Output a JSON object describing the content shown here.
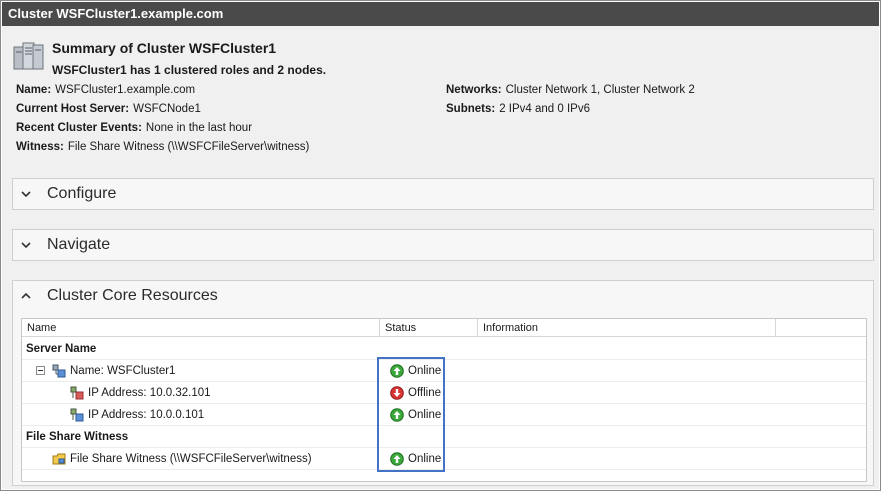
{
  "window": {
    "title": "Cluster WSFCluster1.example.com"
  },
  "summary": {
    "icon": "cluster-server-icon",
    "title": "Summary of Cluster WSFCluster1",
    "subtitle": "WSFCluster1 has 1 clustered roles and 2 nodes."
  },
  "properties_left": [
    {
      "key": "Name:",
      "value": "WSFCluster1.example.com"
    },
    {
      "key": "Current Host Server:",
      "value": "WSFCNode1"
    },
    {
      "key": "Recent Cluster Events:",
      "value": "None in the last hour"
    },
    {
      "key": "Witness:",
      "value": "File Share Witness (\\\\WSFCFileServer\\witness)"
    }
  ],
  "properties_right": [
    {
      "key": "Networks:",
      "value": "Cluster Network 1, Cluster Network 2"
    },
    {
      "key": "Subnets:",
      "value": "2 IPv4 and 0 IPv6"
    }
  ],
  "sections": {
    "configure": {
      "title": "Configure",
      "expanded": false
    },
    "navigate": {
      "title": "Navigate",
      "expanded": false
    },
    "core": {
      "title": "Cluster Core Resources",
      "expanded": true
    }
  },
  "grid": {
    "columns": [
      "Name",
      "Status",
      "Information"
    ],
    "groups": [
      {
        "label": "Server Name",
        "rows": [
          {
            "name": "Name: WSFCluster1",
            "icon": "network-name-icon",
            "status": "Online",
            "status_icon": "online-arrow-icon",
            "level": 0,
            "expandable": true
          },
          {
            "name": "IP Address: 10.0.32.101",
            "icon": "ip-address-icon",
            "status": "Offline",
            "status_icon": "offline-arrow-icon",
            "level": 1
          },
          {
            "name": "IP Address: 10.0.0.101",
            "icon": "ip-address-icon",
            "status": "Online",
            "status_icon": "online-arrow-icon",
            "level": 1
          }
        ]
      },
      {
        "label": "File Share Witness",
        "rows": [
          {
            "name": "File Share Witness (\\\\WSFCFileServer\\witness)",
            "icon": "file-share-icon",
            "status": "Online",
            "status_icon": "online-arrow-icon",
            "level": 0
          }
        ]
      }
    ]
  },
  "colors": {
    "online": "#2e9e2e",
    "offline": "#c62828",
    "highlight": "#4472c4",
    "titlebar": "#4a4a4a"
  }
}
